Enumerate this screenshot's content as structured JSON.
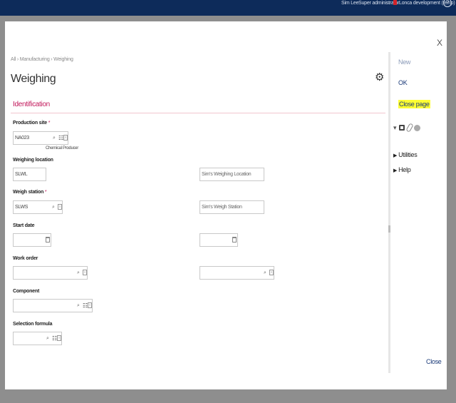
{
  "topbar": {
    "user": "Sim Lee",
    "role": "Super administrator",
    "folder": "Lonca development (temp)",
    "help_icon": "?"
  },
  "modal": {
    "close_x": "X",
    "breadcrumb": "All  ›  Manufacturing  ›  Weighing",
    "title": "Weighing",
    "gear_icon": "⚙",
    "section": "Identification",
    "fields": {
      "production_site": {
        "label": "Production site",
        "required": "*",
        "value": "NA023",
        "description": "Chemical Producer"
      },
      "weighing_location": {
        "label": "Weighing location",
        "value": "SLWL",
        "description": "Sim's Weighing Location"
      },
      "weigh_station": {
        "label": "Weigh station",
        "required": "*",
        "value": "SLWS",
        "description": "Sim's Weigh Station"
      },
      "start_date": {
        "label": "Start date",
        "value": "",
        "value2": ""
      },
      "work_order": {
        "label": "Work order",
        "value": "",
        "value2": ""
      },
      "component": {
        "label": "Component",
        "value": ""
      },
      "selection_formula": {
        "label": "Selection formula",
        "value": ""
      }
    }
  },
  "icons": {
    "search": "⌕",
    "tree": "☷",
    "doc": "≡"
  },
  "side": {
    "actions": {
      "new": "New",
      "ok": "OK",
      "close_page": "Close page"
    },
    "toolbar_caret": "▾",
    "menus": {
      "utilities": "Utilities",
      "help": "Help"
    },
    "triangle": "▶",
    "close": "Close"
  },
  "colors": {
    "topbar": "#0d2b5a",
    "accent": "#c2185b",
    "link": "#1a3a78",
    "highlight": "#ffff33"
  }
}
